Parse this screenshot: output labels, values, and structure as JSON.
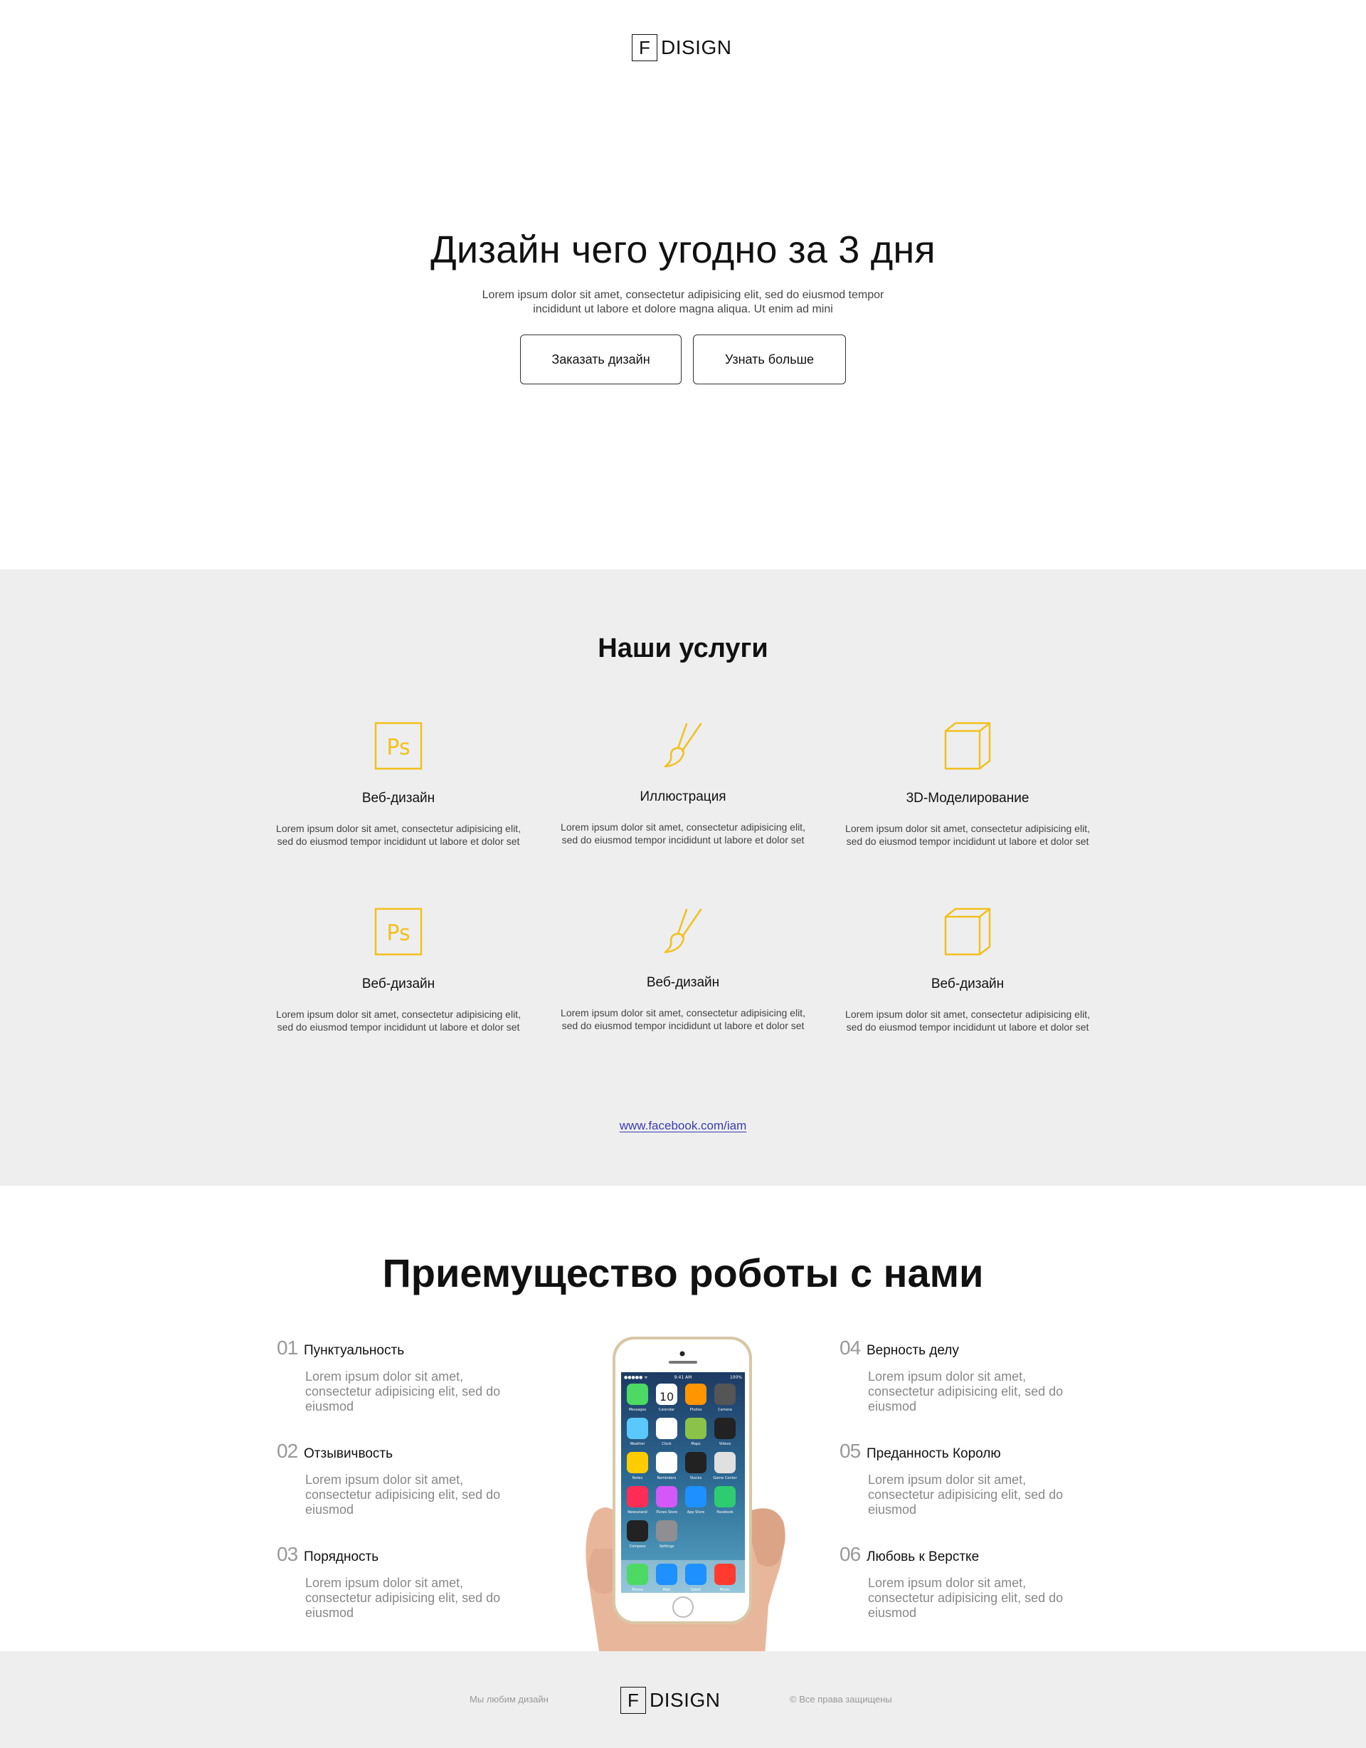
{
  "header": {
    "logo_letter": "F",
    "logo_text": "DISIGN"
  },
  "hero": {
    "title": "Дизайн чего угодно за 3 дня",
    "subtitle": "Lorem ipsum dolor sit amet, consectetur adipisicing elit, sed do eiusmod tempor incididunt ut labore et dolore magna aliqua. Ut enim ad mini",
    "order_button": "Заказать дизайн",
    "more_button": "Узнать больше"
  },
  "services": {
    "title": "Наши услуги",
    "items": [
      {
        "icon": "photoshop-icon",
        "name": "Веб-дизайн",
        "desc": "Lorem ipsum dolor sit amet, consectetur adipisicing elit, sed do eiusmod tempor incididunt ut labore et dolor set"
      },
      {
        "icon": "brush-icon",
        "name": "Иллюстрация",
        "desc": "Lorem ipsum dolor sit amet, consectetur adipisicing elit, sed do eiusmod tempor incididunt ut labore et dolor set"
      },
      {
        "icon": "cube-icon",
        "name": "3D-Моделирование",
        "desc": "Lorem ipsum dolor sit amet, consectetur adipisicing elit, sed do eiusmod tempor incididunt ut labore et dolor set"
      },
      {
        "icon": "photoshop-icon",
        "name": "Веб-дизайн",
        "desc": "Lorem ipsum dolor sit amet, consectetur adipisicing elit, sed do eiusmod tempor incididunt ut labore et dolor set"
      },
      {
        "icon": "brush-icon",
        "name": "Веб-дизайн",
        "desc": "Lorem ipsum dolor sit amet, consectetur adipisicing elit, sed do eiusmod tempor incididunt ut labore et dolor set"
      },
      {
        "icon": "cube-icon",
        "name": "Веб-дизайн",
        "desc": "Lorem ipsum dolor sit amet, consectetur adipisicing elit, sed do eiusmod tempor incididunt ut labore et dolor set"
      }
    ],
    "link": "www.facebook.com/iam",
    "icon_color": "#f2c01c"
  },
  "advantages": {
    "title": "Приемущество роботы с нами",
    "items": [
      {
        "num": "01",
        "name": "Пунктуальность",
        "desc": "Lorem ipsum dolor sit amet, consectetur adipisicing elit, sed do eiusmod"
      },
      {
        "num": "02",
        "name": "Отзывичвость",
        "desc": "Lorem ipsum dolor sit amet, consectetur adipisicing elit, sed do eiusmod"
      },
      {
        "num": "03",
        "name": "Порядность",
        "desc": "Lorem ipsum dolor sit amet, consectetur adipisicing elit, sed do eiusmod"
      },
      {
        "num": "04",
        "name": "Верность делу",
        "desc": "Lorem ipsum dolor sit amet, consectetur adipisicing elit, sed do eiusmod"
      },
      {
        "num": "05",
        "name": "Преданность Королю",
        "desc": "Lorem ipsum dolor sit amet, consectetur adipisicing elit, sed do eiusmod"
      },
      {
        "num": "06",
        "name": "Любовь к Верстке",
        "desc": "Lorem ipsum dolor sit amet, consectetur adipisicing elit, sed do eiusmod"
      }
    ],
    "phone": {
      "time": "9:41 AM",
      "battery": "100%",
      "calendar_date": "10",
      "apps": [
        "Messages",
        "Calendar",
        "Photos",
        "Camera",
        "Weather",
        "Clock",
        "Maps",
        "Videos",
        "Notes",
        "Reminders",
        "Stocks",
        "Game Center",
        "Newsstand",
        "iTunes Store",
        "App Store",
        "Passbook",
        "Compass",
        "Settings"
      ],
      "dock": [
        "Phone",
        "Mail",
        "Safari",
        "Music"
      ]
    }
  },
  "footer": {
    "left_text": "Мы любим дизайн",
    "logo_letter": "F",
    "logo_text": "DISIGN",
    "right_text": "© Все права защищены"
  }
}
